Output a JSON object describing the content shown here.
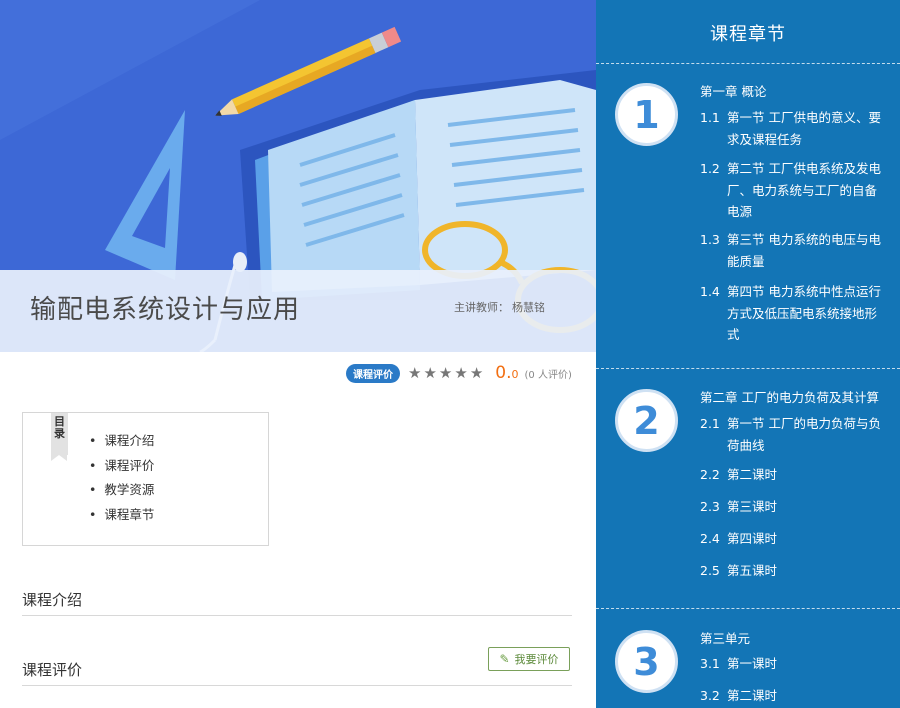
{
  "course": {
    "title": "输配电系统设计与应用",
    "teacher_label": "主讲教师：",
    "teacher_name": "杨慧铭",
    "rating_badge": "课程评价",
    "stars": 5,
    "score": "0.",
    "score_decimal": "0",
    "raters": "(0 人评价)"
  },
  "toc": {
    "tag": "目录",
    "items": [
      "课程介绍",
      "课程评价",
      "教学资源",
      "课程章节"
    ]
  },
  "sections": {
    "intro_heading": "课程介绍",
    "review_heading": "课程评价",
    "review_button": "我要评价"
  },
  "sidebar": {
    "title": "课程章节",
    "chapters": [
      {
        "number": "1",
        "title": "第一章 概论",
        "lessons": [
          {
            "num": "1.1",
            "text": "第一节 工厂供电的意义、要求及课程任务"
          },
          {
            "num": "1.2",
            "text": "第二节 工厂供电系统及发电厂、电力系统与工厂的自备电源"
          },
          {
            "num": "1.3",
            "text": "第三节 电力系统的电压与电能质量"
          },
          {
            "num": "1.4",
            "text": "第四节 电力系统中性点运行方式及低压配电系统接地形式"
          }
        ]
      },
      {
        "number": "2",
        "title": "第二章 工厂的电力负荷及其计算",
        "lessons": [
          {
            "num": "2.1",
            "text": "第一节 工厂的电力负荷与负荷曲线"
          },
          {
            "num": "2.2",
            "text": "第二课时"
          },
          {
            "num": "2.3",
            "text": "第三课时"
          },
          {
            "num": "2.4",
            "text": "第四课时"
          },
          {
            "num": "2.5",
            "text": "第五课时"
          }
        ]
      },
      {
        "number": "3",
        "title": "第三单元",
        "lessons": [
          {
            "num": "3.1",
            "text": "第一课时"
          },
          {
            "num": "3.2",
            "text": "第二课时"
          }
        ]
      }
    ]
  },
  "colors": {
    "banner_bg": "#3d68d6",
    "sidebar_bg": "#1375b6",
    "accent_blue": "#2a7ac7",
    "score_orange": "#f26f12",
    "button_green": "#5c8a3a"
  }
}
